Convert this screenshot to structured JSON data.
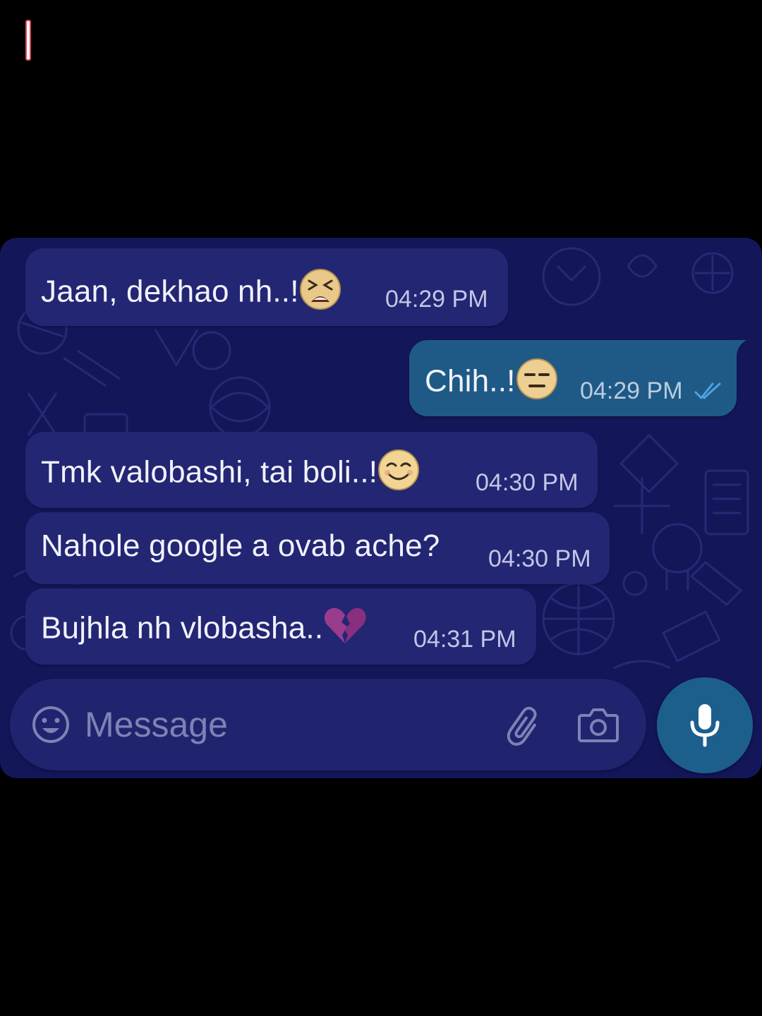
{
  "messages": [
    {
      "direction": "incoming",
      "text": "Jaan, dekhao nh..!",
      "emoji": "weary-face-icon",
      "time": "04:29 PM"
    },
    {
      "direction": "outgoing",
      "text": "Chih..!",
      "emoji": "expressionless-face-icon",
      "time": "04:29 PM",
      "status": "read"
    },
    {
      "direction": "incoming",
      "text": "Tmk valobashi, tai boli..!",
      "emoji": "smiling-face-icon",
      "time": "04:30 PM"
    },
    {
      "direction": "incoming",
      "text": "Nahole google a ovab ache?",
      "emoji": "",
      "time": "04:30 PM"
    },
    {
      "direction": "incoming",
      "text": "Bujhla nh vlobasha..",
      "emoji": "broken-heart-icon",
      "time": "04:31 PM"
    }
  ],
  "composer": {
    "placeholder": "Message",
    "icons": [
      "emoji-icon",
      "attach-paperclip-icon",
      "camera-icon",
      "microphone-icon"
    ]
  },
  "colors": {
    "background": "#000000",
    "chat_wallpaper": "#14165a",
    "incoming_bubble": "#232673",
    "outgoing_bubble": "#1f5a86",
    "read_ticks": "#4fa3e0",
    "mic_button": "#1d5f8c"
  }
}
